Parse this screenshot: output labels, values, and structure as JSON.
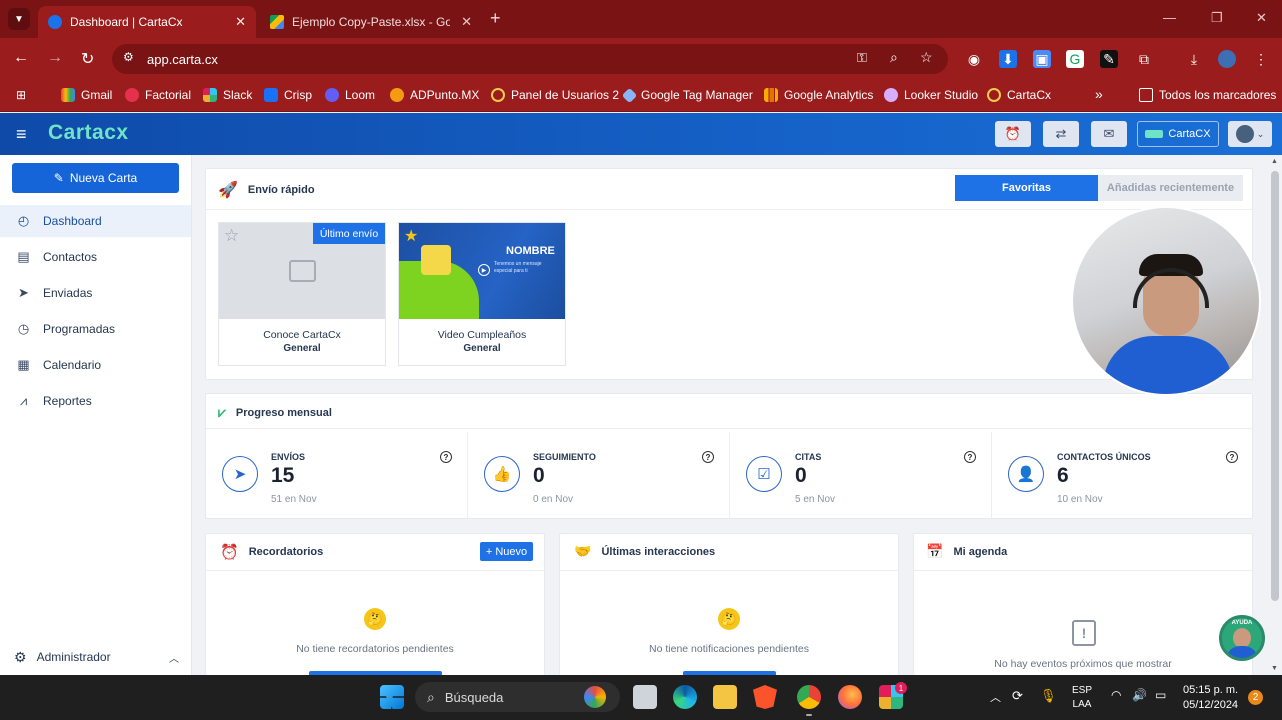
{
  "browser": {
    "tabs": [
      {
        "title": "Dashboard | CartaCx",
        "close": "✕"
      },
      {
        "title": "Ejemplo Copy-Paste.xlsx - Goog",
        "close": "✕"
      }
    ],
    "new_tab": "+",
    "url": "app.carta.cx",
    "bookmarks": [
      "Gmail",
      "Factorial",
      "Slack",
      "Crisp",
      "Loom",
      "ADPunto.MX",
      "Panel de Usuarios 2",
      "Google Tag Manager",
      "Google Analytics",
      "Looker Studio",
      "CartaCx"
    ],
    "bookmarks_overflow": "»",
    "all_bookmarks": "Todos los marcadores"
  },
  "app": {
    "logo": "Cartacx",
    "brand_button": "CartaCX",
    "sidebar": {
      "new_card": "Nueva Carta",
      "items": [
        {
          "label": "Dashboard",
          "icon": "dashboard-icon"
        },
        {
          "label": "Contactos",
          "icon": "contacts-icon"
        },
        {
          "label": "Enviadas",
          "icon": "send-icon"
        },
        {
          "label": "Programadas",
          "icon": "clock-icon"
        },
        {
          "label": "Calendario",
          "icon": "calendar-icon"
        },
        {
          "label": "Reportes",
          "icon": "reports-icon"
        }
      ],
      "admin": "Administrador"
    },
    "quick_send": {
      "title": "Envío rápido",
      "tab_favorites": "Favoritas",
      "tab_recent": "Añadidas recientemente",
      "templates": [
        {
          "name": "Conoce CartaCx",
          "category": "General",
          "badge": "Último envío"
        },
        {
          "name": "Video Cumpleaños",
          "category": "General",
          "thumb_title": "NOMBRE",
          "thumb_sub": "Tenemos un mensaje especial para ti"
        }
      ]
    },
    "progress": {
      "title": "Progreso mensual",
      "metrics": [
        {
          "label": "ENVÍOS",
          "value": "15",
          "sub": "51 en Nov",
          "icon": "paper-plane-icon"
        },
        {
          "label": "SEGUIMIENTO",
          "value": "0",
          "sub": "0 en Nov",
          "icon": "thumbs-up-icon"
        },
        {
          "label": "CITAS",
          "value": "0",
          "sub": "5 en Nov",
          "icon": "calendar-check-icon"
        },
        {
          "label": "CONTACTOS ÚNICOS",
          "value": "6",
          "sub": "10 en Nov",
          "icon": "add-user-icon"
        }
      ]
    },
    "reminders": {
      "title": "Recordatorios",
      "new_button": "+ Nuevo",
      "empty": "No tiene recordatorios pendientes"
    },
    "interactions": {
      "title": "Últimas interacciones",
      "empty": "No tiene notificaciones pendientes"
    },
    "agenda": {
      "title": "Mi agenda",
      "empty": "No hay eventos próximos que mostrar"
    },
    "help_fab": "AYUDA"
  },
  "taskbar": {
    "search": "Búsqueda",
    "lang_top": "ESP",
    "lang_bottom": "LAA",
    "time": "05:15 p. m.",
    "date": "05/12/2024",
    "notifications": "2",
    "slack_badge": "1"
  },
  "colors": {
    "chrome": "#9b1c1c",
    "header": "#1561c7",
    "accent": "#1e72e6"
  }
}
